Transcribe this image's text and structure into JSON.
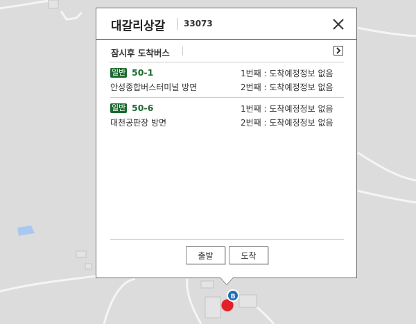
{
  "popup": {
    "stop_name": "대갈리상갈",
    "stop_id": "33073",
    "section_title": "잠시후 도착버스",
    "routes": [
      {
        "badge": "일반",
        "number": "50-1",
        "direction": "안성종합버스터미널 방면",
        "arrival_1": "1번째 : 도착예정정보 없음",
        "arrival_2": "2번째 : 도착예정정보 없음"
      },
      {
        "badge": "일반",
        "number": "50-6",
        "direction": "대천공판장 방면",
        "arrival_1": "1번째 : 도착예정정보 없음",
        "arrival_2": "2번째 : 도착예정정보 없음"
      }
    ],
    "buttons": {
      "depart": "출발",
      "arrive": "도착"
    }
  },
  "map": {
    "bus_stop_marker_label": "B"
  },
  "colors": {
    "route_green": "#1c6a2f",
    "map_bg": "#dcdcdc",
    "marker_red": "#e2202a",
    "stop_blue": "#1f6fb5"
  }
}
